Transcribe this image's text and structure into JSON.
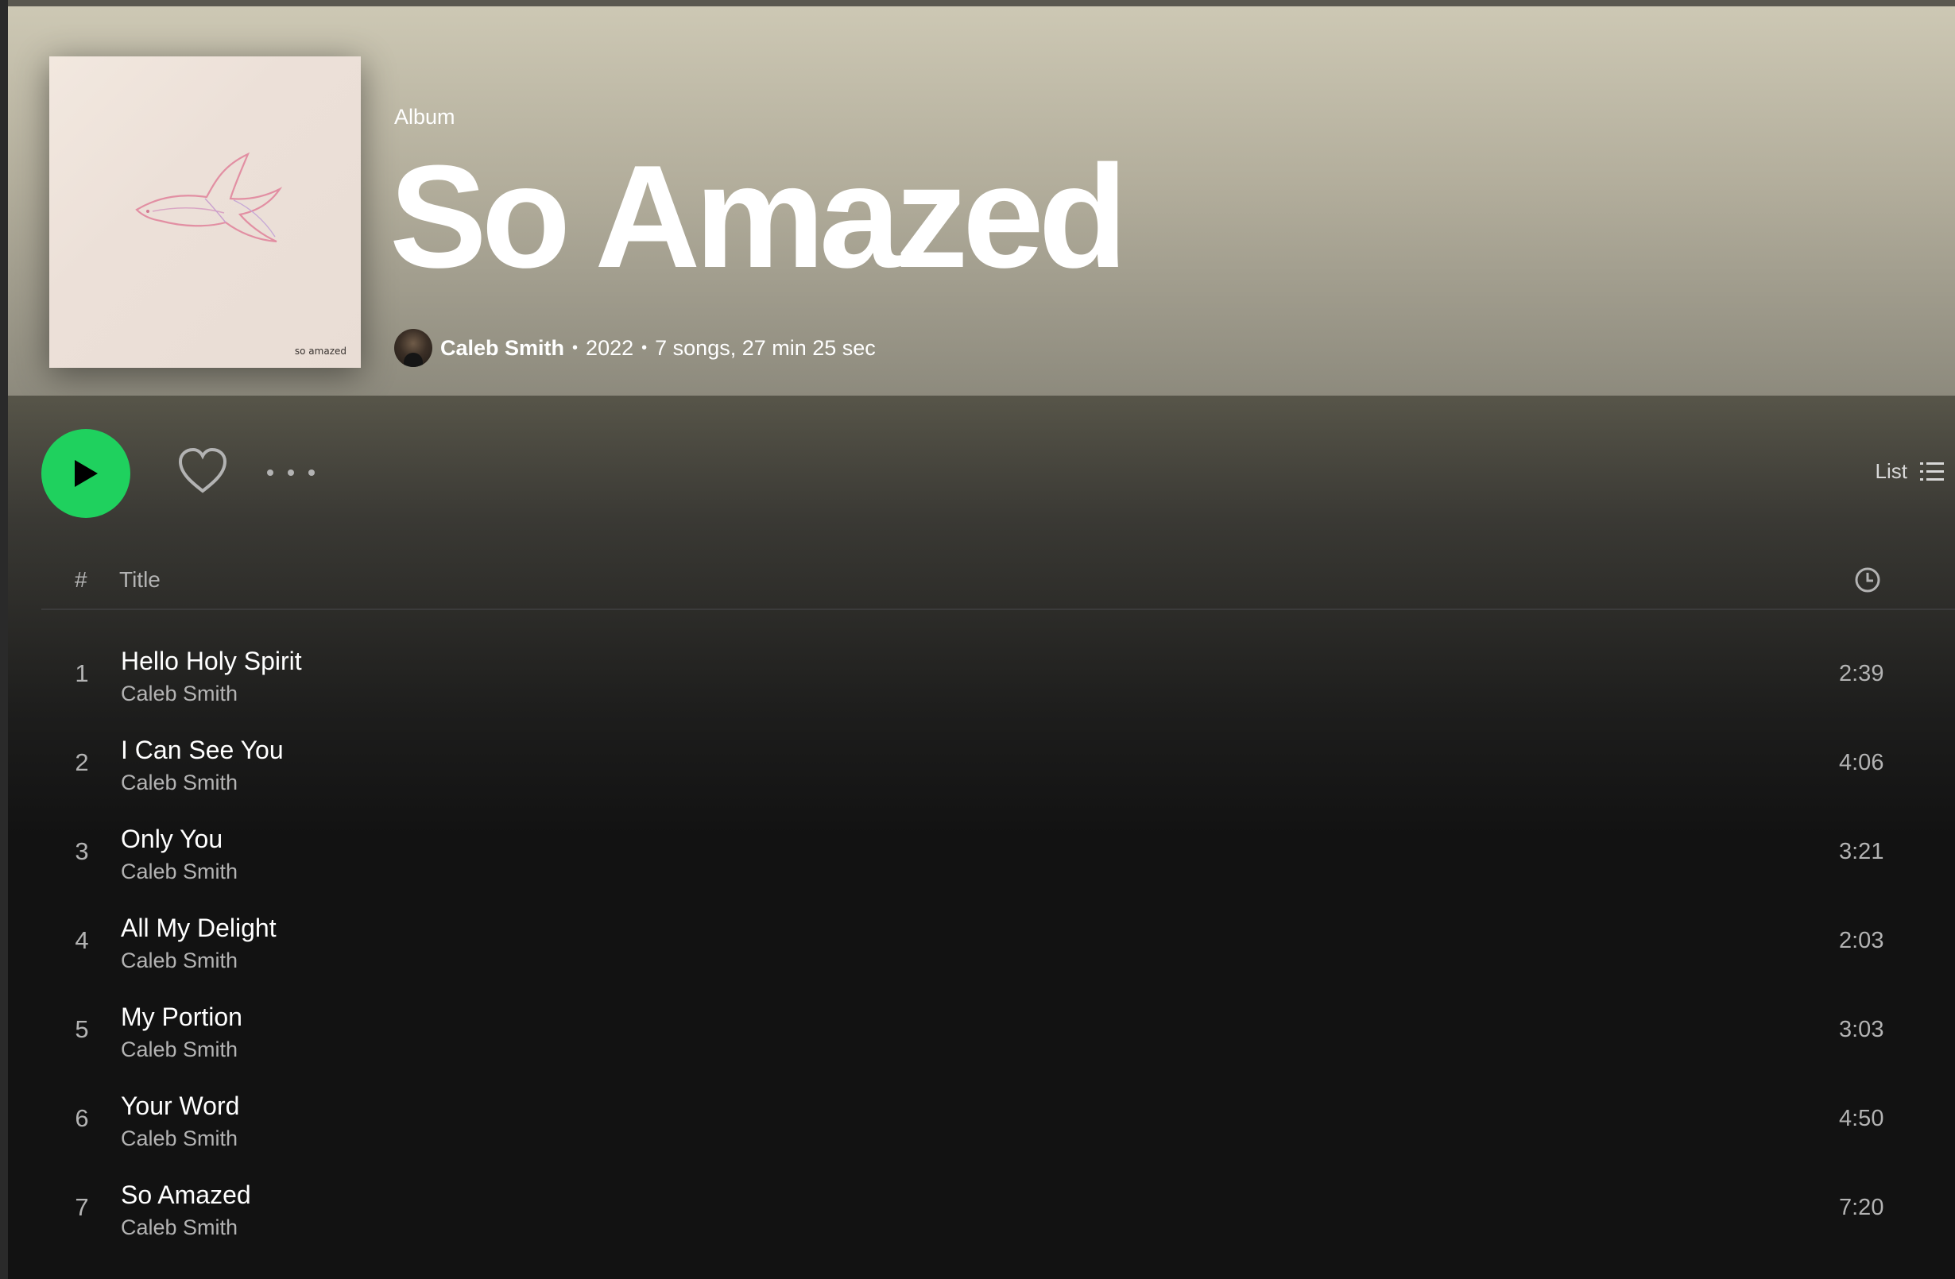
{
  "album": {
    "kind_label": "Album",
    "title": "So Amazed",
    "cover_caption": "so amazed",
    "artist": "Caleb Smith",
    "year": "2022",
    "summary": "7 songs, 27 min 25 sec",
    "separator": "•"
  },
  "controls": {
    "view_label": "List"
  },
  "table": {
    "header_number": "#",
    "header_title": "Title"
  },
  "tracks": [
    {
      "number": "1",
      "title": "Hello Holy Spirit",
      "artist": "Caleb Smith",
      "duration": "2:39"
    },
    {
      "number": "2",
      "title": "I Can See You",
      "artist": "Caleb Smith",
      "duration": "4:06"
    },
    {
      "number": "3",
      "title": "Only You",
      "artist": "Caleb Smith",
      "duration": "3:21"
    },
    {
      "number": "4",
      "title": "All My Delight",
      "artist": "Caleb Smith",
      "duration": "2:03"
    },
    {
      "number": "5",
      "title": "My Portion",
      "artist": "Caleb Smith",
      "duration": "3:03"
    },
    {
      "number": "6",
      "title": "Your Word",
      "artist": "Caleb Smith",
      "duration": "4:50"
    },
    {
      "number": "7",
      "title": "So Amazed",
      "artist": "Caleb Smith",
      "duration": "7:20"
    }
  ],
  "icons": {
    "play": "play-icon",
    "like": "heart-icon",
    "more": "more-options-icon",
    "view": "list-view-icon",
    "duration": "clock-icon"
  },
  "colors": {
    "accent": "#1ed760",
    "background": "#121212",
    "header_top": "#cdc8b4"
  }
}
